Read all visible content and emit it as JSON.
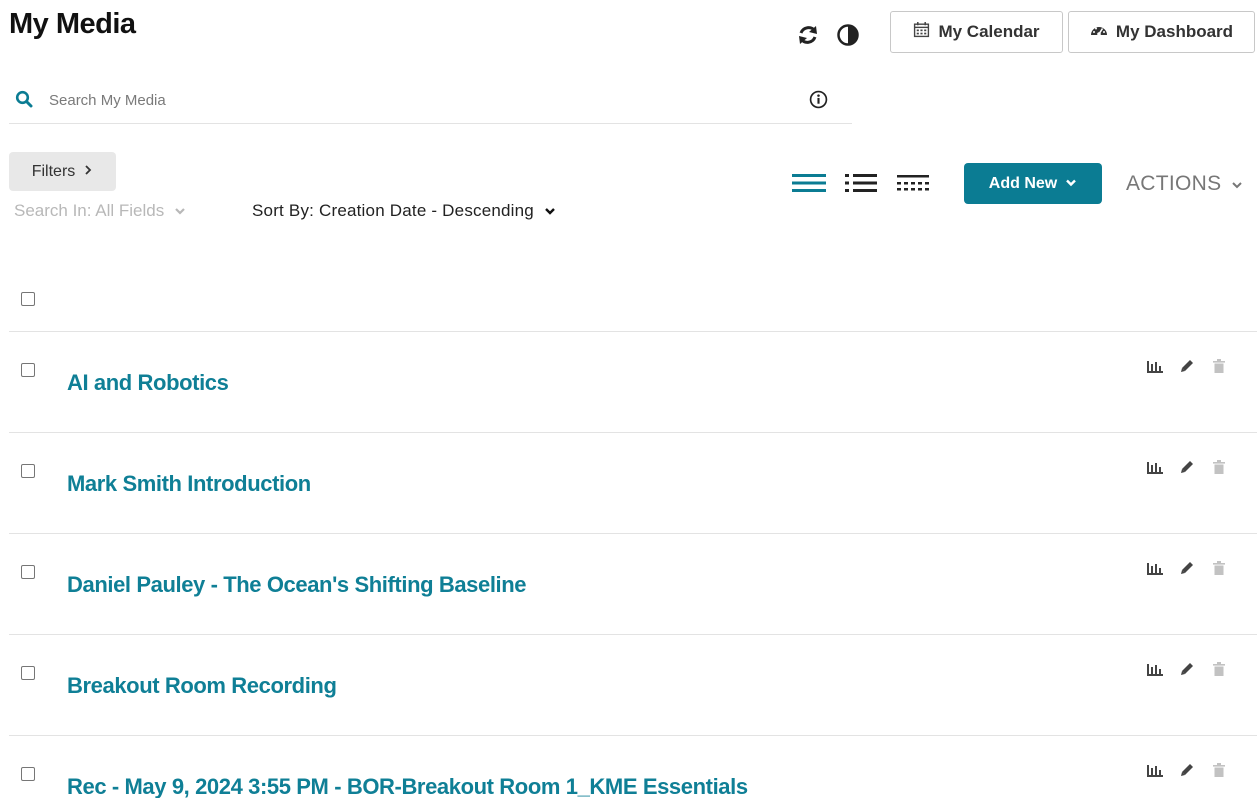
{
  "header": {
    "title": "My Media",
    "calendar_label": "My Calendar",
    "dashboard_label": "My Dashboard",
    "icons": [
      "refresh-icon",
      "contrast-icon",
      "calendar-icon",
      "dashboard-icon"
    ]
  },
  "search": {
    "placeholder": "Search My Media",
    "value": ""
  },
  "filters": {
    "filters_label": "Filters",
    "search_in_label": "Search In: All Fields",
    "sort_by_label": "Sort By: Creation Date - Descending"
  },
  "toolbar": {
    "add_new_label": "Add New",
    "actions_label": "ACTIONS",
    "view_modes": [
      "detailed-view-icon",
      "list-view-icon",
      "compact-view-icon"
    ]
  },
  "media": {
    "items": [
      {
        "title": "AI and Robotics"
      },
      {
        "title": "Mark Smith Introduction"
      },
      {
        "title": "Daniel Pauley - The Ocean's Shifting Baseline"
      },
      {
        "title": "Breakout Room Recording"
      },
      {
        "title": "Rec - May 9, 2024 3:55 PM - BOR-Breakout Room 1_KME Essentials"
      }
    ],
    "row_action_icons": [
      "analytics-icon",
      "edit-icon",
      "delete-icon"
    ]
  },
  "colors": {
    "accent": "#0b7c93",
    "link": "#0f7f96",
    "muted": "#b8b8b8"
  }
}
